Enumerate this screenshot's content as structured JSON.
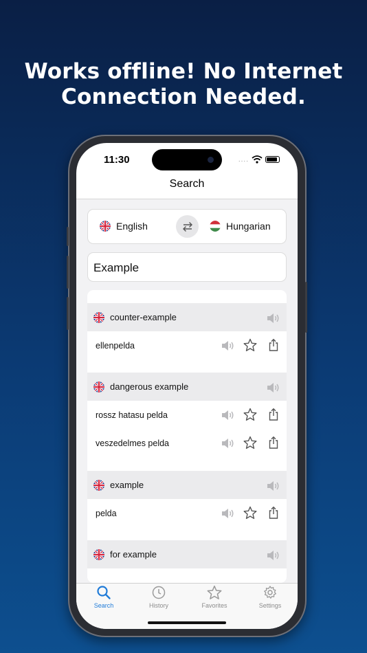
{
  "promo": {
    "headline_line1": "Works offline! No Internet",
    "headline_line2": "Connection Needed."
  },
  "status_bar": {
    "time": "11:30",
    "signal_dots": "...."
  },
  "nav": {
    "title": "Search"
  },
  "languages": {
    "source": {
      "label": "English",
      "flag_icon": "uk-flag-icon"
    },
    "target": {
      "label": "Hungarian",
      "flag_icon": "hungary-flag-icon"
    },
    "swap_icon": "swap-arrows-icon"
  },
  "search": {
    "value": "Example"
  },
  "results": [
    {
      "word": "counter-example",
      "translations": [
        "ellenpelda"
      ]
    },
    {
      "word": "dangerous example",
      "translations": [
        "rossz hatasu pelda",
        "veszedelmes pelda"
      ]
    },
    {
      "word": "example",
      "translations": [
        "pelda"
      ]
    },
    {
      "word": "for example",
      "translations": []
    }
  ],
  "tabbar": {
    "items": [
      {
        "label": "Search",
        "icon": "search-icon",
        "active": true
      },
      {
        "label": "History",
        "icon": "clock-icon",
        "active": false
      },
      {
        "label": "Favorites",
        "icon": "star-icon",
        "active": false
      },
      {
        "label": "Settings",
        "icon": "gear-icon",
        "active": false
      }
    ]
  },
  "colors": {
    "accent": "#1f7bd8",
    "background_top": "#0a1f45",
    "background_bottom": "#0d4f8f"
  }
}
